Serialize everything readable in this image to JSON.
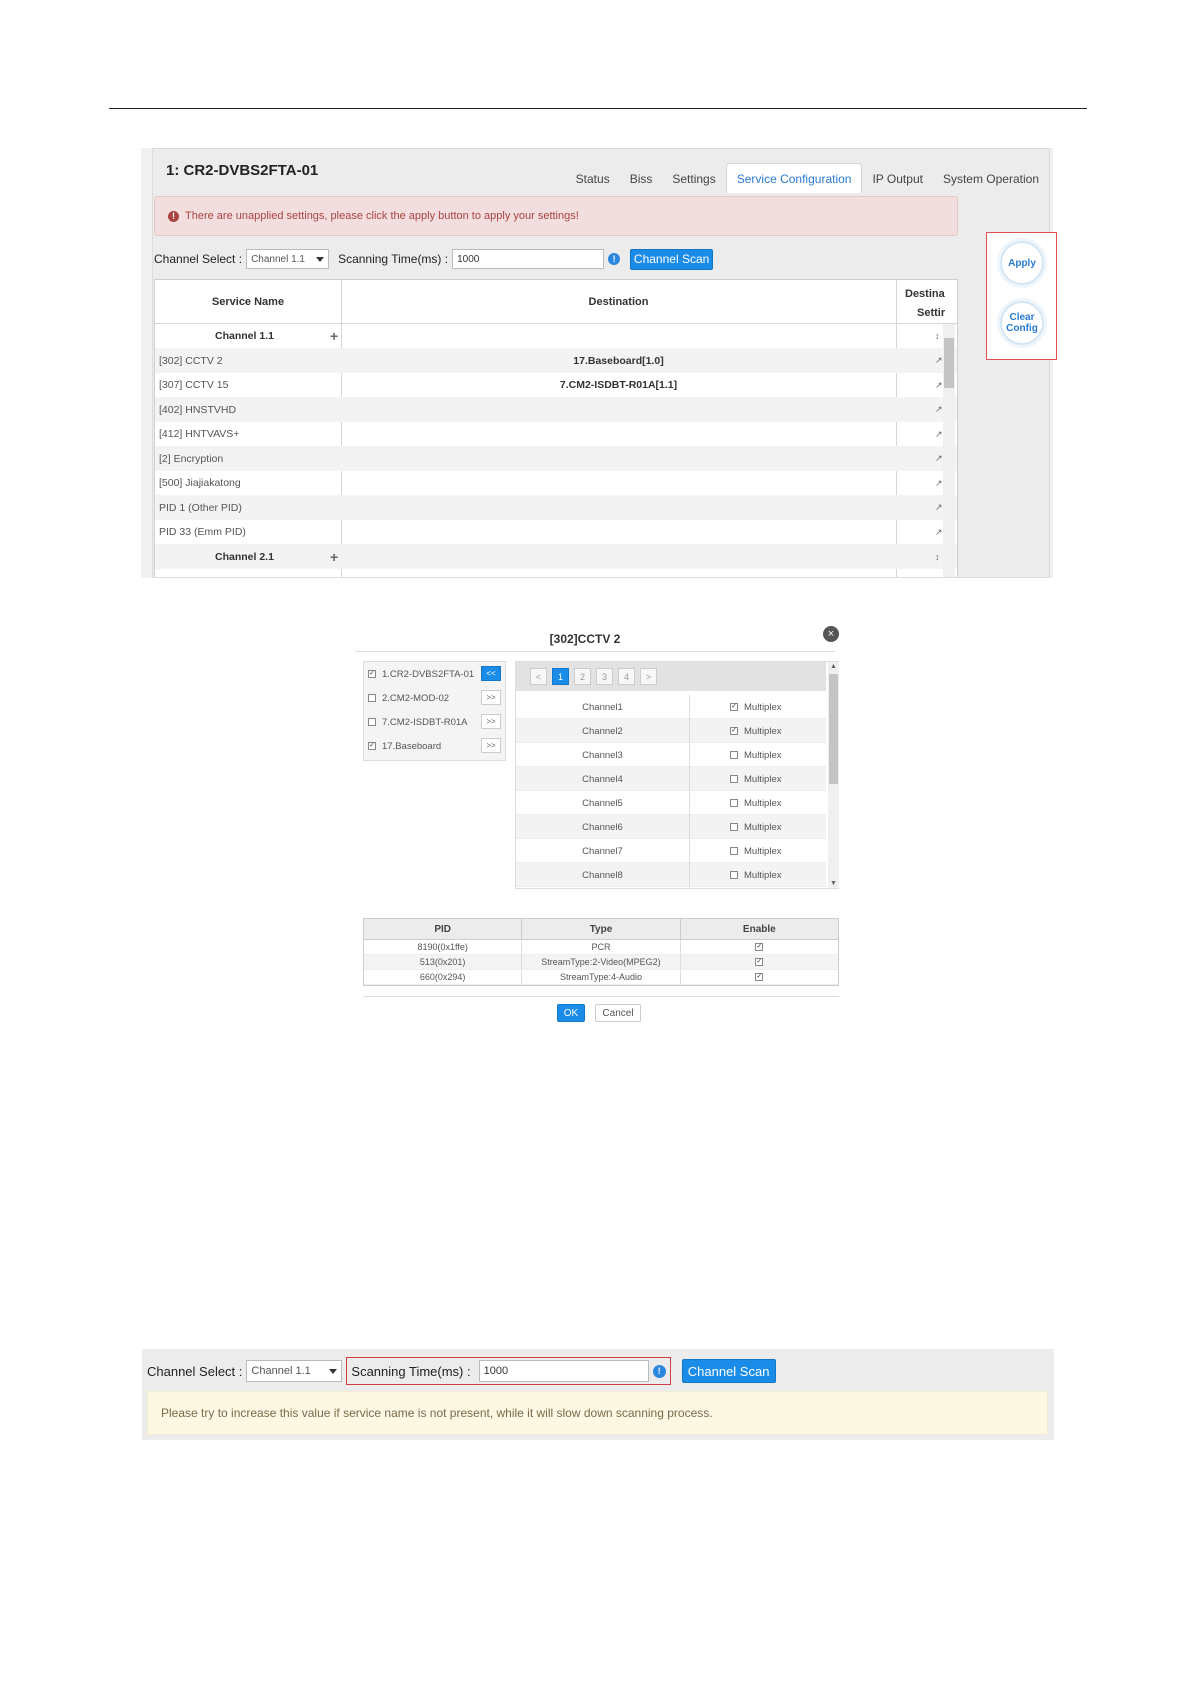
{
  "shot1": {
    "title": "1: CR2-DVBS2FTA-01",
    "tabs": [
      {
        "label": "Status",
        "active": false
      },
      {
        "label": "Biss",
        "active": false
      },
      {
        "label": "Settings",
        "active": false
      },
      {
        "label": "Service Configuration",
        "active": true
      },
      {
        "label": "IP Output",
        "active": false
      },
      {
        "label": "System Operation",
        "active": false
      }
    ],
    "alert": "There are unapplied settings, please click the apply button to apply your settings!",
    "channel_select_label": "Channel Select :",
    "channel_select_value": "Channel 1.1",
    "scanning_label": "Scanning Time(ms) :",
    "scanning_value": "1000",
    "channel_scan_button": "Channel Scan",
    "table_headers": {
      "service": "Service Name",
      "destination": "Destination",
      "dest_settings_1": "Destina",
      "dest_settings_2": "Settir"
    },
    "rows": [
      {
        "name": "Channel 1.1",
        "dest": "",
        "group": true
      },
      {
        "name": "[302] CCTV 2",
        "dest": "17.Baseboard[1.0]",
        "group": false
      },
      {
        "name": "[307] CCTV 15",
        "dest": "7.CM2-ISDBT-R01A[1.1]",
        "group": false
      },
      {
        "name": "[402] HNSTVHD",
        "dest": "",
        "group": false
      },
      {
        "name": "[412] HNTVAVS+",
        "dest": "",
        "group": false
      },
      {
        "name": "[2] Encryption",
        "dest": "",
        "group": false
      },
      {
        "name": "[500] Jiajiakatong",
        "dest": "",
        "group": false
      },
      {
        "name": "PID 1 (Other PID)",
        "dest": "",
        "group": false
      },
      {
        "name": "PID 33 (Emm PID)",
        "dest": "",
        "group": false
      },
      {
        "name": "Channel 2.1",
        "dest": "",
        "group": true
      }
    ],
    "apply_button": "Apply",
    "clear_config_line1": "Clear",
    "clear_config_line2": "Config"
  },
  "dialog": {
    "title": "[302]CCTV 2",
    "devices": [
      {
        "label": "1.CR2-DVBS2FTA-01",
        "checked": true,
        "btn": "<<",
        "active": true
      },
      {
        "label": "2.CM2-MOD-02",
        "checked": false,
        "btn": ">>",
        "active": false
      },
      {
        "label": "7.CM2-ISDBT-R01A",
        "checked": false,
        "btn": ">>",
        "active": false
      },
      {
        "label": "17.Baseboard",
        "checked": true,
        "btn": ">>",
        "active": false
      }
    ],
    "pager": [
      {
        "label": "<",
        "active": false
      },
      {
        "label": "1",
        "active": true
      },
      {
        "label": "2",
        "active": false
      },
      {
        "label": "3",
        "active": false
      },
      {
        "label": "4",
        "active": false
      },
      {
        "label": ">",
        "active": false
      }
    ],
    "channels": [
      {
        "name": "Channel1",
        "multiplex": "Multiplex",
        "checked": true
      },
      {
        "name": "Channel2",
        "multiplex": "Multiplex",
        "checked": true
      },
      {
        "name": "Channel3",
        "multiplex": "Multiplex",
        "checked": false
      },
      {
        "name": "Channel4",
        "multiplex": "Multiplex",
        "checked": false
      },
      {
        "name": "Channel5",
        "multiplex": "Multiplex",
        "checked": false
      },
      {
        "name": "Channel6",
        "multiplex": "Multiplex",
        "checked": false
      },
      {
        "name": "Channel7",
        "multiplex": "Multiplex",
        "checked": false
      },
      {
        "name": "Channel8",
        "multiplex": "Multiplex",
        "checked": false
      }
    ],
    "pid_headers": {
      "pid": "PID",
      "type": "Type",
      "enable": "Enable"
    },
    "pids": [
      {
        "pid": "8190(0x1ffe)",
        "type": "PCR",
        "enabled": true
      },
      {
        "pid": "513(0x201)",
        "type": "StreamType:2-Video(MPEG2)",
        "enabled": true
      },
      {
        "pid": "660(0x294)",
        "type": "StreamType:4-Audio",
        "enabled": true
      }
    ],
    "ok_button": "OK",
    "cancel_button": "Cancel"
  },
  "shot3": {
    "channel_select_label": "Channel Select :",
    "channel_select_value": "Channel 1.1",
    "scanning_label": "Scanning Time(ms) :",
    "scanning_value": "1000",
    "channel_scan_button": "Channel Scan",
    "hint": "Please try to increase this value if service name is not present, while it will slow down scanning process."
  }
}
